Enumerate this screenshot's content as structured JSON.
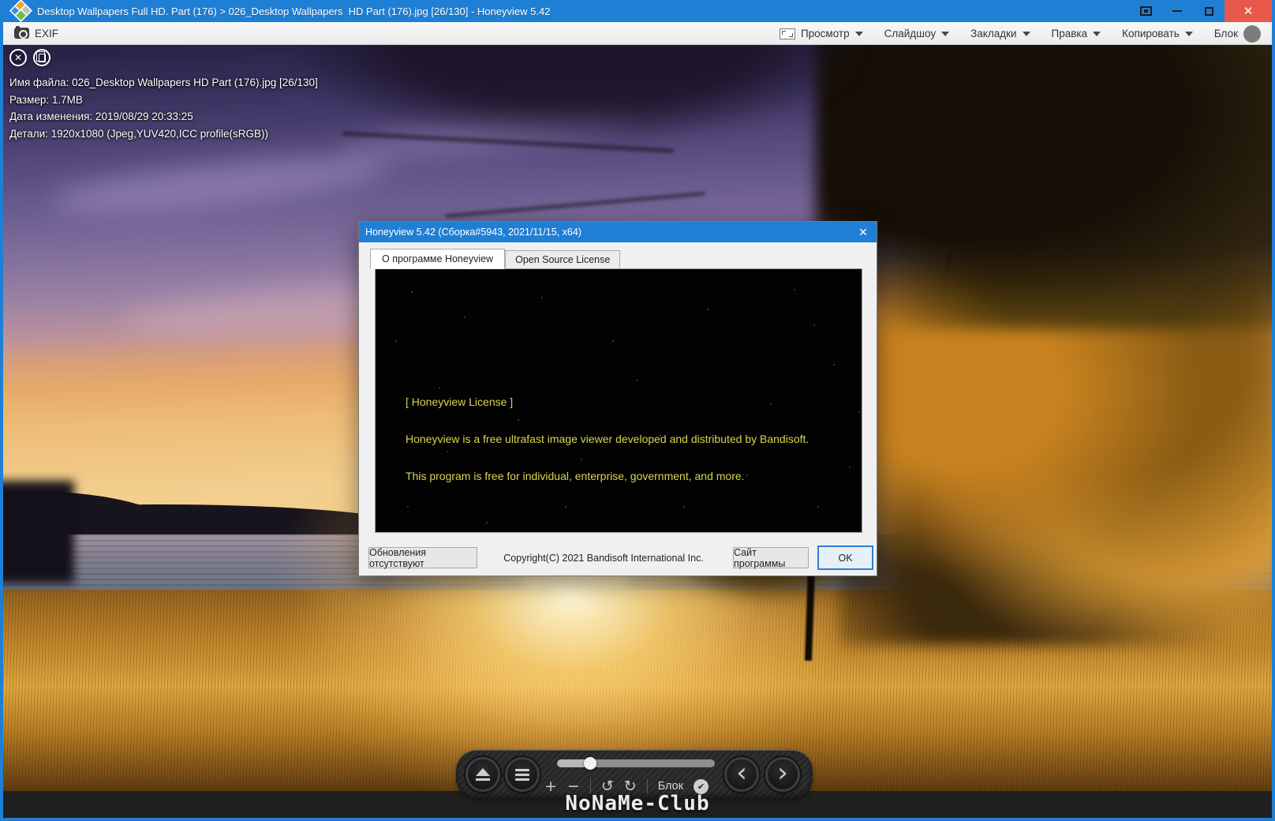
{
  "window": {
    "title": "Desktop Wallpapers Full HD. Part (176) > 026_Desktop Wallpapers  HD Part (176).jpg [26/130] - Honeyview 5.42",
    "controls": {
      "close_glyph": "✕"
    }
  },
  "toolbar": {
    "exif_label": "EXIF",
    "menus": [
      {
        "label": "Просмотр"
      },
      {
        "label": "Слайдшоу"
      },
      {
        "label": "Закладки"
      },
      {
        "label": "Правка"
      },
      {
        "label": "Копировать"
      }
    ],
    "block_label": "Блок"
  },
  "exif_overlay": {
    "close_glyph": "✕",
    "lines": [
      "Имя файла: 026_Desktop Wallpapers HD Part (176).jpg [26/130]",
      "Размер: 1.7MB",
      "Дата изменения: 2019/08/29 20:33:25",
      "Детали: 1920x1080 (Jpeg,YUV420,ICC profile(sRGB))"
    ]
  },
  "dialog": {
    "title": "Honeyview 5.42 (Сборка#5943, 2021/11/15, x64)",
    "close_glyph": "✕",
    "tabs": [
      {
        "label": "О программе Honeyview"
      },
      {
        "label": "Open Source License"
      }
    ],
    "license": {
      "heading": "[ Honeyview License ]",
      "line1": "Honeyview is a free ultrafast image viewer developed and distributed by Bandisoft.",
      "line2": "This program is free for individual, enterprise, government, and more."
    },
    "copyright": "Copyright(C) 2021 Bandisoft International Inc.",
    "buttons": {
      "updates": "Обновления отсутствуют",
      "site": "Сайт программы",
      "ok": "OK"
    }
  },
  "bottom_bar": {
    "zoom_in": "+",
    "zoom_out": "−",
    "rotate_left": "↺",
    "rotate_right": "↻",
    "block_label": "Блок",
    "check_glyph": "✔",
    "prev_glyph": "‹",
    "next_glyph": "›"
  },
  "watermark": {
    "text": "NoNaMe-Club"
  },
  "colors": {
    "titlebar_blue": "#1f7fd5",
    "close_red": "#e8594b",
    "license_yellow": "#d6d64f"
  }
}
